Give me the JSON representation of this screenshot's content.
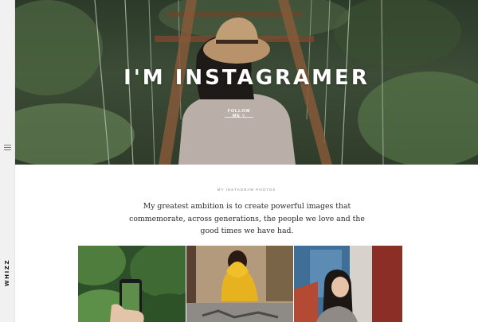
{
  "sidebar": {
    "brand": "WHIZZ",
    "menu_icon": "hamburger-menu-icon"
  },
  "hero": {
    "title": "I'M INSTAGRAMER",
    "follow_label": "FOLLOW ME",
    "follow_icon": "chevron-down-icon"
  },
  "intro": {
    "eyebrow": "MY INSTAGRAM PHOTOS",
    "text": "My greatest ambition is to create powerful images that commemorate, across generations, the people we love and the good times we have had."
  },
  "photos": [
    {
      "subject": "hand-holding-phone-in-jungle"
    },
    {
      "subject": "woman-in-yellow-scarf-at-market"
    },
    {
      "subject": "woman-leaning-against-wall"
    }
  ],
  "colors": {
    "sidebar_bg": "#f1f1f1",
    "text": "#2a2a2a",
    "muted": "#888888",
    "hero_text": "#ffffff"
  }
}
